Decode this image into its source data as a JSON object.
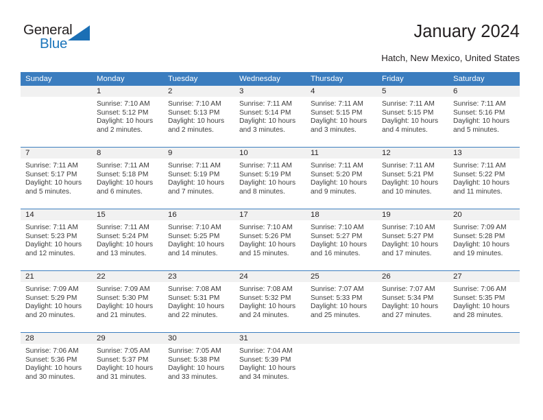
{
  "brand": {
    "name_part1": "General",
    "name_part2": "Blue",
    "triangle_icon": "blue-triangle-icon",
    "accent_color": "#1b75bb"
  },
  "header": {
    "title": "January 2024",
    "subtitle": "Hatch, New Mexico, United States"
  },
  "calendar": {
    "header_bg": "#3b7dbf",
    "daynum_bg": "#f1f1f1",
    "weekdays": [
      "Sunday",
      "Monday",
      "Tuesday",
      "Wednesday",
      "Thursday",
      "Friday",
      "Saturday"
    ],
    "weeks": [
      [
        {
          "day": "",
          "sunrise": "",
          "sunset": "",
          "daylight_line1": "",
          "daylight_line2": ""
        },
        {
          "day": "1",
          "sunrise": "Sunrise: 7:10 AM",
          "sunset": "Sunset: 5:12 PM",
          "daylight_line1": "Daylight: 10 hours",
          "daylight_line2": "and 2 minutes."
        },
        {
          "day": "2",
          "sunrise": "Sunrise: 7:10 AM",
          "sunset": "Sunset: 5:13 PM",
          "daylight_line1": "Daylight: 10 hours",
          "daylight_line2": "and 2 minutes."
        },
        {
          "day": "3",
          "sunrise": "Sunrise: 7:11 AM",
          "sunset": "Sunset: 5:14 PM",
          "daylight_line1": "Daylight: 10 hours",
          "daylight_line2": "and 3 minutes."
        },
        {
          "day": "4",
          "sunrise": "Sunrise: 7:11 AM",
          "sunset": "Sunset: 5:15 PM",
          "daylight_line1": "Daylight: 10 hours",
          "daylight_line2": "and 3 minutes."
        },
        {
          "day": "5",
          "sunrise": "Sunrise: 7:11 AM",
          "sunset": "Sunset: 5:15 PM",
          "daylight_line1": "Daylight: 10 hours",
          "daylight_line2": "and 4 minutes."
        },
        {
          "day": "6",
          "sunrise": "Sunrise: 7:11 AM",
          "sunset": "Sunset: 5:16 PM",
          "daylight_line1": "Daylight: 10 hours",
          "daylight_line2": "and 5 minutes."
        }
      ],
      [
        {
          "day": "7",
          "sunrise": "Sunrise: 7:11 AM",
          "sunset": "Sunset: 5:17 PM",
          "daylight_line1": "Daylight: 10 hours",
          "daylight_line2": "and 5 minutes."
        },
        {
          "day": "8",
          "sunrise": "Sunrise: 7:11 AM",
          "sunset": "Sunset: 5:18 PM",
          "daylight_line1": "Daylight: 10 hours",
          "daylight_line2": "and 6 minutes."
        },
        {
          "day": "9",
          "sunrise": "Sunrise: 7:11 AM",
          "sunset": "Sunset: 5:19 PM",
          "daylight_line1": "Daylight: 10 hours",
          "daylight_line2": "and 7 minutes."
        },
        {
          "day": "10",
          "sunrise": "Sunrise: 7:11 AM",
          "sunset": "Sunset: 5:19 PM",
          "daylight_line1": "Daylight: 10 hours",
          "daylight_line2": "and 8 minutes."
        },
        {
          "day": "11",
          "sunrise": "Sunrise: 7:11 AM",
          "sunset": "Sunset: 5:20 PM",
          "daylight_line1": "Daylight: 10 hours",
          "daylight_line2": "and 9 minutes."
        },
        {
          "day": "12",
          "sunrise": "Sunrise: 7:11 AM",
          "sunset": "Sunset: 5:21 PM",
          "daylight_line1": "Daylight: 10 hours",
          "daylight_line2": "and 10 minutes."
        },
        {
          "day": "13",
          "sunrise": "Sunrise: 7:11 AM",
          "sunset": "Sunset: 5:22 PM",
          "daylight_line1": "Daylight: 10 hours",
          "daylight_line2": "and 11 minutes."
        }
      ],
      [
        {
          "day": "14",
          "sunrise": "Sunrise: 7:11 AM",
          "sunset": "Sunset: 5:23 PM",
          "daylight_line1": "Daylight: 10 hours",
          "daylight_line2": "and 12 minutes."
        },
        {
          "day": "15",
          "sunrise": "Sunrise: 7:11 AM",
          "sunset": "Sunset: 5:24 PM",
          "daylight_line1": "Daylight: 10 hours",
          "daylight_line2": "and 13 minutes."
        },
        {
          "day": "16",
          "sunrise": "Sunrise: 7:10 AM",
          "sunset": "Sunset: 5:25 PM",
          "daylight_line1": "Daylight: 10 hours",
          "daylight_line2": "and 14 minutes."
        },
        {
          "day": "17",
          "sunrise": "Sunrise: 7:10 AM",
          "sunset": "Sunset: 5:26 PM",
          "daylight_line1": "Daylight: 10 hours",
          "daylight_line2": "and 15 minutes."
        },
        {
          "day": "18",
          "sunrise": "Sunrise: 7:10 AM",
          "sunset": "Sunset: 5:27 PM",
          "daylight_line1": "Daylight: 10 hours",
          "daylight_line2": "and 16 minutes."
        },
        {
          "day": "19",
          "sunrise": "Sunrise: 7:10 AM",
          "sunset": "Sunset: 5:27 PM",
          "daylight_line1": "Daylight: 10 hours",
          "daylight_line2": "and 17 minutes."
        },
        {
          "day": "20",
          "sunrise": "Sunrise: 7:09 AM",
          "sunset": "Sunset: 5:28 PM",
          "daylight_line1": "Daylight: 10 hours",
          "daylight_line2": "and 19 minutes."
        }
      ],
      [
        {
          "day": "21",
          "sunrise": "Sunrise: 7:09 AM",
          "sunset": "Sunset: 5:29 PM",
          "daylight_line1": "Daylight: 10 hours",
          "daylight_line2": "and 20 minutes."
        },
        {
          "day": "22",
          "sunrise": "Sunrise: 7:09 AM",
          "sunset": "Sunset: 5:30 PM",
          "daylight_line1": "Daylight: 10 hours",
          "daylight_line2": "and 21 minutes."
        },
        {
          "day": "23",
          "sunrise": "Sunrise: 7:08 AM",
          "sunset": "Sunset: 5:31 PM",
          "daylight_line1": "Daylight: 10 hours",
          "daylight_line2": "and 22 minutes."
        },
        {
          "day": "24",
          "sunrise": "Sunrise: 7:08 AM",
          "sunset": "Sunset: 5:32 PM",
          "daylight_line1": "Daylight: 10 hours",
          "daylight_line2": "and 24 minutes."
        },
        {
          "day": "25",
          "sunrise": "Sunrise: 7:07 AM",
          "sunset": "Sunset: 5:33 PM",
          "daylight_line1": "Daylight: 10 hours",
          "daylight_line2": "and 25 minutes."
        },
        {
          "day": "26",
          "sunrise": "Sunrise: 7:07 AM",
          "sunset": "Sunset: 5:34 PM",
          "daylight_line1": "Daylight: 10 hours",
          "daylight_line2": "and 27 minutes."
        },
        {
          "day": "27",
          "sunrise": "Sunrise: 7:06 AM",
          "sunset": "Sunset: 5:35 PM",
          "daylight_line1": "Daylight: 10 hours",
          "daylight_line2": "and 28 minutes."
        }
      ],
      [
        {
          "day": "28",
          "sunrise": "Sunrise: 7:06 AM",
          "sunset": "Sunset: 5:36 PM",
          "daylight_line1": "Daylight: 10 hours",
          "daylight_line2": "and 30 minutes."
        },
        {
          "day": "29",
          "sunrise": "Sunrise: 7:05 AM",
          "sunset": "Sunset: 5:37 PM",
          "daylight_line1": "Daylight: 10 hours",
          "daylight_line2": "and 31 minutes."
        },
        {
          "day": "30",
          "sunrise": "Sunrise: 7:05 AM",
          "sunset": "Sunset: 5:38 PM",
          "daylight_line1": "Daylight: 10 hours",
          "daylight_line2": "and 33 minutes."
        },
        {
          "day": "31",
          "sunrise": "Sunrise: 7:04 AM",
          "sunset": "Sunset: 5:39 PM",
          "daylight_line1": "Daylight: 10 hours",
          "daylight_line2": "and 34 minutes."
        },
        {
          "day": "",
          "sunrise": "",
          "sunset": "",
          "daylight_line1": "",
          "daylight_line2": ""
        },
        {
          "day": "",
          "sunrise": "",
          "sunset": "",
          "daylight_line1": "",
          "daylight_line2": ""
        },
        {
          "day": "",
          "sunrise": "",
          "sunset": "",
          "daylight_line1": "",
          "daylight_line2": ""
        }
      ]
    ]
  }
}
